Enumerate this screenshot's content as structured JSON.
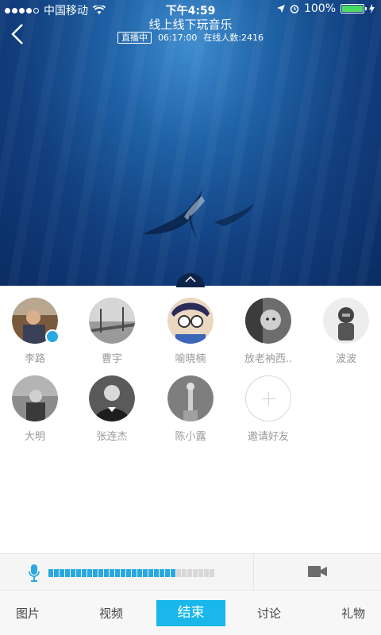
{
  "status": {
    "carrier": "中国移动",
    "time": "下午4:59",
    "battery": "100%"
  },
  "header": {
    "title": "线上线下玩音乐",
    "badge": "直播中",
    "duration": "06:17:00",
    "online": "在线人数:2416"
  },
  "members": [
    {
      "name": "李路",
      "speaking": true
    },
    {
      "name": "曹宇"
    },
    {
      "name": "喻晓楠"
    },
    {
      "name": "放老衲西.."
    },
    {
      "name": "波波"
    },
    {
      "name": "大明"
    },
    {
      "name": "张连杰"
    },
    {
      "name": "陈小露"
    }
  ],
  "invite": {
    "label": "邀请好友"
  },
  "mic": {
    "level": 0.76,
    "accent": "#2aa8e0"
  },
  "tabs": {
    "photos": "图片",
    "video": "视频",
    "end": "结束",
    "discuss": "讨论",
    "gift": "礼物"
  },
  "colors": {
    "accent": "#19b7ea",
    "hero": "#1a4f8f"
  }
}
